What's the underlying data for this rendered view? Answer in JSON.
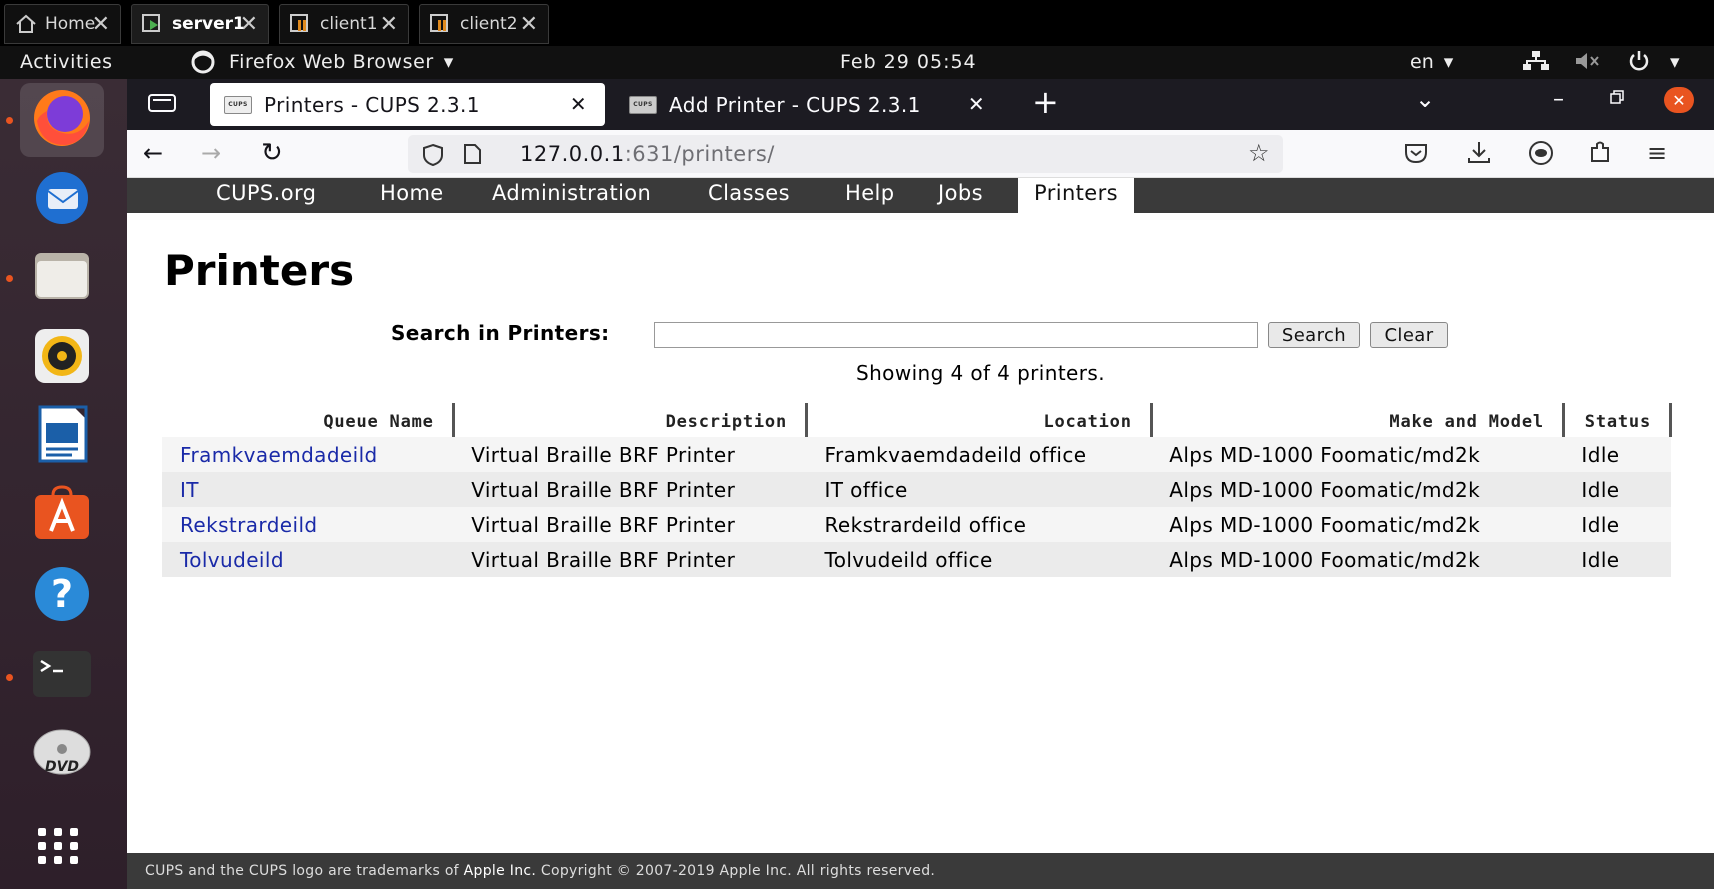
{
  "vm_tabs": [
    {
      "label": "Home",
      "active": false
    },
    {
      "label": "server1",
      "active": true
    },
    {
      "label": "client1",
      "active": false
    },
    {
      "label": "client2",
      "active": false
    }
  ],
  "topbar": {
    "activities": "Activities",
    "app_menu": "Firefox Web Browser",
    "clock": "Feb 29  05:54",
    "lang": "en"
  },
  "dock": {
    "items": [
      "firefox-icon",
      "thunderbird-icon",
      "files-icon",
      "rhythmbox-icon",
      "writer-icon",
      "software-icon",
      "help-icon",
      "terminal-icon",
      "dvd-icon",
      "app-grid-icon"
    ]
  },
  "browser": {
    "tabs": [
      {
        "label": "Printers - CUPS 2.3.1",
        "active": true
      },
      {
        "label": "Add Printer - CUPS 2.3.1",
        "active": false
      }
    ],
    "url_host": "127.0.0.1",
    "url_path": ":631/printers/",
    "favicon_text": "CUPS"
  },
  "cups_nav": [
    "CUPS.org",
    "Home",
    "Administration",
    "Classes",
    "Help",
    "Jobs",
    "Printers"
  ],
  "page": {
    "title": "Printers",
    "search_label": "Search in Printers:",
    "search_value": "",
    "search_button": "Search",
    "clear_button": "Clear",
    "showing": "Showing 4 of 4 printers."
  },
  "table": {
    "headers": [
      "Queue Name",
      "Description",
      "Location",
      "Make and Model",
      "Status"
    ],
    "rows": [
      [
        "Framkvaemdadeild",
        "Virtual Braille BRF Printer",
        "Framkvaemdadeild office",
        "Alps MD-1000 Foomatic/md2k",
        "Idle"
      ],
      [
        "IT",
        "Virtual Braille BRF Printer",
        "IT office",
        "Alps MD-1000 Foomatic/md2k",
        "Idle"
      ],
      [
        "Rekstrardeild",
        "Virtual Braille BRF Printer",
        "Rekstrardeild office",
        "Alps MD-1000 Foomatic/md2k",
        "Idle"
      ],
      [
        "Tolvudeild",
        "Virtual Braille BRF Printer",
        "Tolvudeild office",
        "Alps MD-1000 Foomatic/md2k",
        "Idle"
      ]
    ]
  },
  "footer": {
    "prefix": "CUPS and the CUPS logo are trademarks of ",
    "company": "Apple Inc.",
    "suffix": " Copyright © 2007-2019 Apple Inc. All rights reserved."
  },
  "colors": {
    "link": "#1a2aa8",
    "nav_bar": "#3a3a3a",
    "accent": "#e95420"
  }
}
